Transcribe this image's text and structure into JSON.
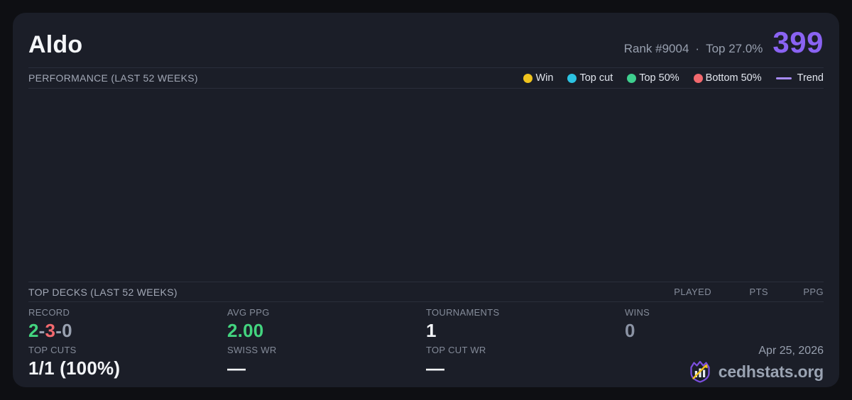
{
  "header": {
    "player_name": "Aldo",
    "rank_label": "Rank #9004",
    "dot_separator": "·",
    "top_percent_label": "Top 27.0%",
    "score": "399"
  },
  "performance": {
    "section_title": "PERFORMANCE (LAST 52 WEEKS)",
    "legend": [
      {
        "label": "Win",
        "color": "#f0c41e",
        "marker": "dot"
      },
      {
        "label": "Top cut",
        "color": "#2cc3e2",
        "marker": "dot"
      },
      {
        "label": "Top 50%",
        "color": "#3ecf8e",
        "marker": "dot"
      },
      {
        "label": "Bottom 50%",
        "color": "#f2696e",
        "marker": "dot"
      },
      {
        "label": "Trend",
        "color": "#a78bfa",
        "marker": "line"
      }
    ]
  },
  "top_decks": {
    "section_title": "TOP DECKS (LAST 52 WEEKS)",
    "columns": [
      "PLAYED",
      "PTS",
      "PPG"
    ],
    "rows": []
  },
  "stats": {
    "record": {
      "label": "RECORD",
      "wins": "2",
      "losses": "3",
      "draws": "0",
      "separator": "-"
    },
    "avg_ppg": {
      "label": "AVG PPG",
      "value": "2.00"
    },
    "tournaments": {
      "label": "TOURNAMENTS",
      "value": "1"
    },
    "wins": {
      "label": "WINS",
      "value": "0"
    },
    "top_cuts": {
      "label": "TOP CUTS",
      "value": "1/1 (100%)"
    },
    "swiss_wr": {
      "label": "SWISS WR",
      "value": "—"
    },
    "top_cut_wr": {
      "label": "TOP CUT WR",
      "value": "—"
    }
  },
  "footer": {
    "date": "Apr 25, 2026",
    "brand_name": "cedhstats.org",
    "logo": "cedhstats-shield-logo"
  },
  "colors": {
    "accent_purple": "#8a63f2",
    "win_green": "#43d47f",
    "loss_red": "#f2696e",
    "neutral_gray": "#99a1b0",
    "trend_purple": "#a78bfa"
  }
}
